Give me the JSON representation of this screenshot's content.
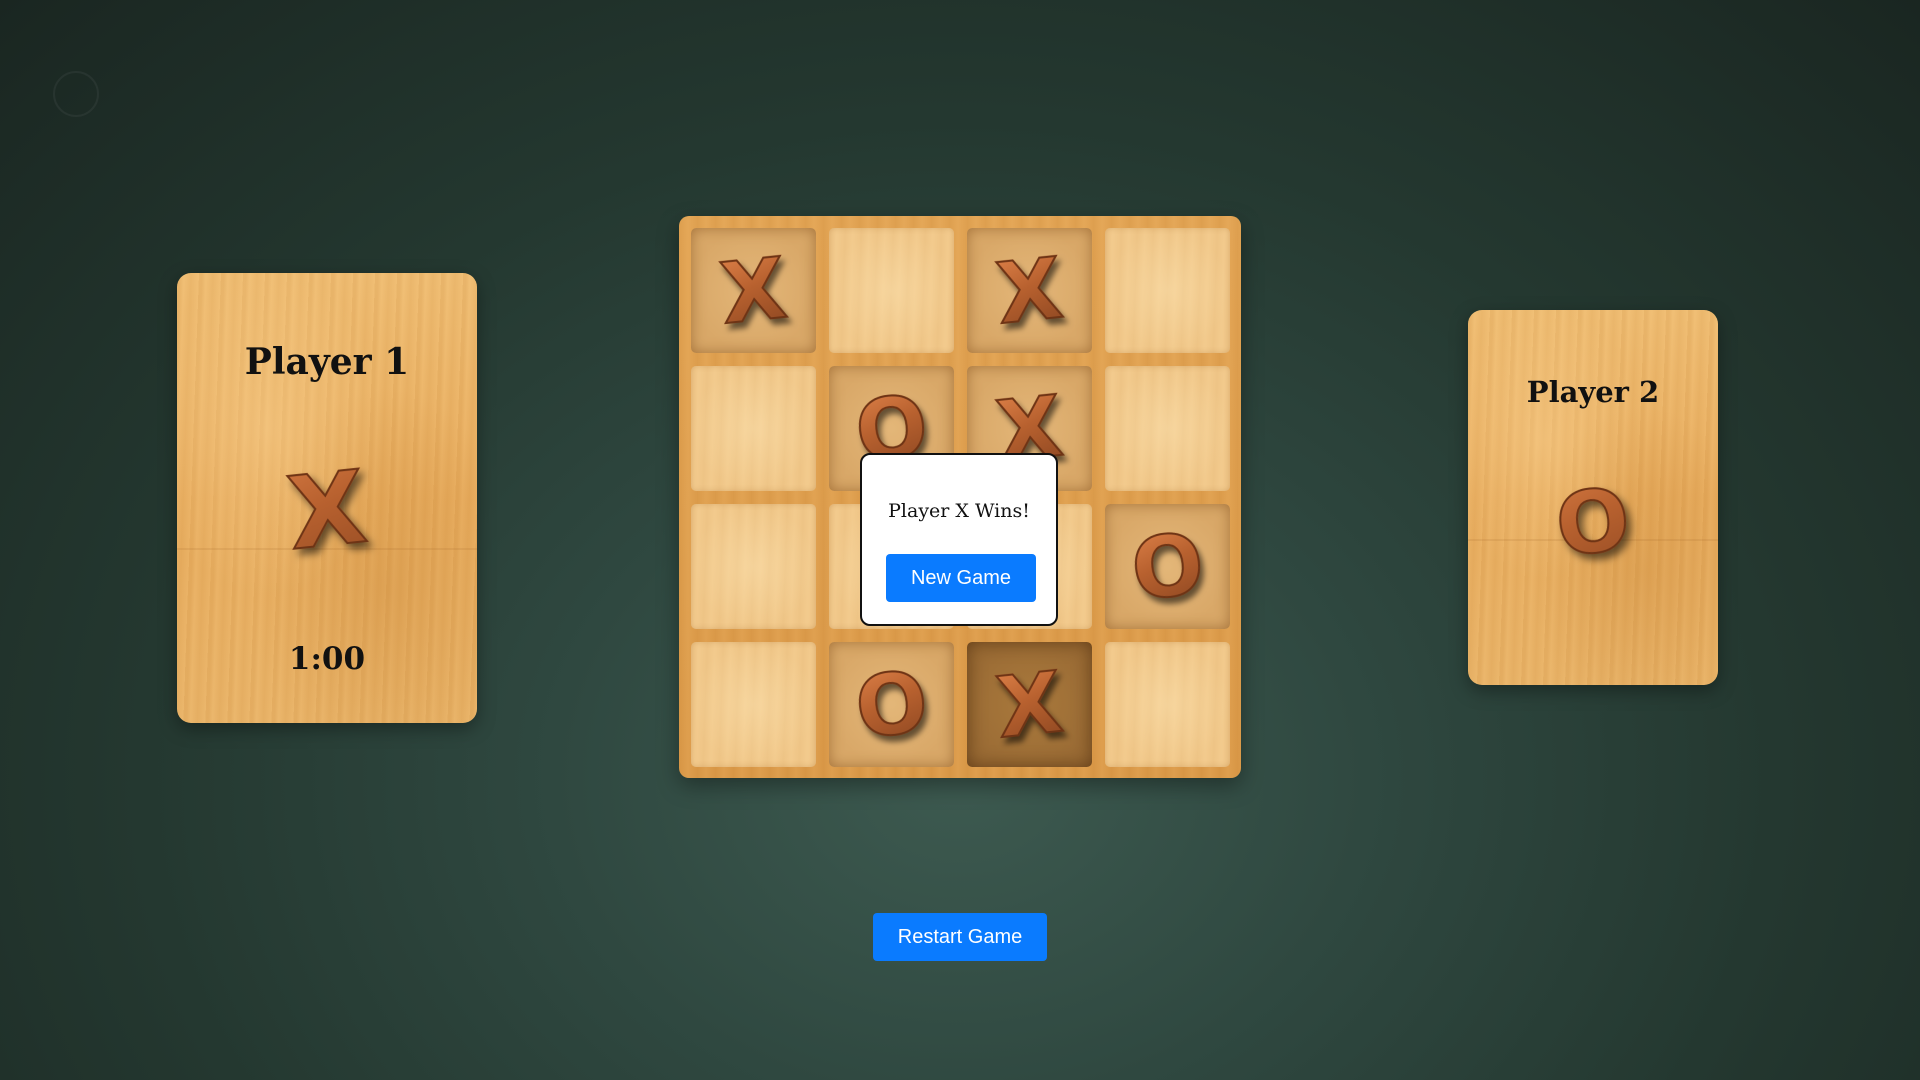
{
  "player1": {
    "title": "Player 1",
    "symbol": "X",
    "timer": "1:00"
  },
  "player2": {
    "title": "Player 2",
    "symbol": "O"
  },
  "board": {
    "rows": [
      [
        "X",
        "",
        "X",
        ""
      ],
      [
        "",
        "O",
        "X",
        ""
      ],
      [
        "",
        "",
        "",
        "O"
      ],
      [
        "",
        "O",
        "X",
        ""
      ]
    ],
    "highlighted_cell": "row 4, column 3"
  },
  "modal": {
    "message": "Player X Wins!",
    "new_game_label": "New Game"
  },
  "controls": {
    "restart_label": "Restart Game"
  },
  "colors": {
    "background": "#2f4840",
    "wood": "#e9ad5e",
    "button": "#0a7bff",
    "mark": "#b8612f"
  }
}
